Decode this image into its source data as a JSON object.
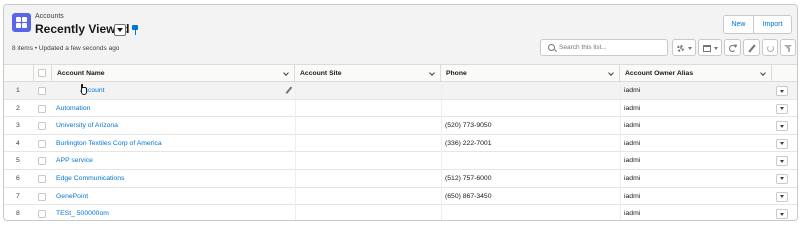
{
  "header": {
    "object_label": "Accounts",
    "list_view_name": "Recently Viewed",
    "meta": "8 items • Updated a few seconds ago",
    "buttons": {
      "new": "New",
      "import": "Import"
    },
    "search_placeholder": "Search this list...",
    "icons": [
      "accounts-object-icon",
      "pin-icon",
      "gear-icon",
      "table-icon",
      "refresh-icon",
      "pencil-icon",
      "chart-icon",
      "filter-icon"
    ]
  },
  "table": {
    "columns": [
      "Account Name",
      "Account Site",
      "Phone",
      "Account Owner Alias"
    ],
    "rows": [
      {
        "num": "1",
        "name": "Account",
        "site": "",
        "phone": "",
        "alias": "iadmi"
      },
      {
        "num": "2",
        "name": "Automation",
        "site": "",
        "phone": "",
        "alias": "iadmi"
      },
      {
        "num": "3",
        "name": "University of Arizona",
        "site": "",
        "phone": "(520) 773-9050",
        "alias": "iadmi"
      },
      {
        "num": "4",
        "name": "Burlington Textiles Corp of America",
        "site": "",
        "phone": "(336) 222-7001",
        "alias": "iadmi"
      },
      {
        "num": "5",
        "name": "APP service",
        "site": "",
        "phone": "",
        "alias": "iadmi"
      },
      {
        "num": "6",
        "name": "Edge Communications",
        "site": "",
        "phone": "(512) 757-6000",
        "alias": "iadmi"
      },
      {
        "num": "7",
        "name": "GenePoint",
        "site": "",
        "phone": "(650) 867-3450",
        "alias": "iadmi"
      },
      {
        "num": "8",
        "name": "TESt_ 500000om",
        "site": "",
        "phone": "",
        "alias": "iadmi"
      }
    ]
  },
  "colors": {
    "accent": "#0176d3",
    "object_icon": "#5867e8",
    "header_bg": "#f3f3f3",
    "border": "#dddbda"
  }
}
